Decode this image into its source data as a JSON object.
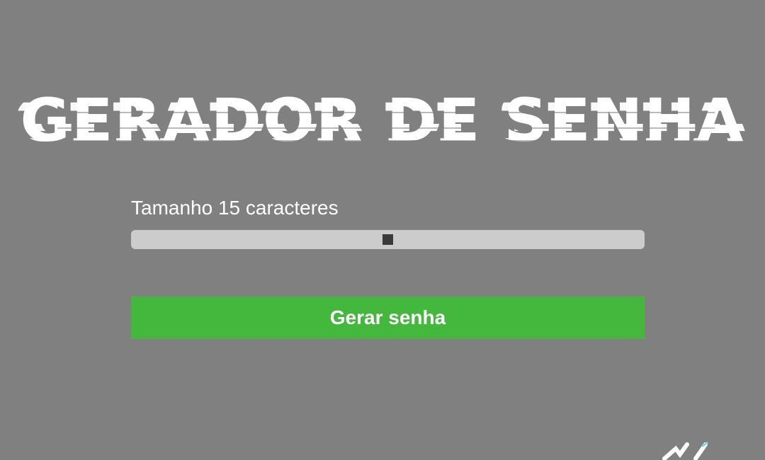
{
  "header": {
    "title": "GERADOR DE SENHA"
  },
  "settings": {
    "length_label": "Tamanho 15 caracteres",
    "length_value": 15,
    "slider_fraction": 0.5
  },
  "actions": {
    "generate_label": "Gerar senha"
  },
  "colors": {
    "background": "#808080",
    "slider_track": "#cccccc",
    "slider_thumb": "#3a3a3a",
    "button": "#43b83d",
    "text": "#ffffff"
  }
}
